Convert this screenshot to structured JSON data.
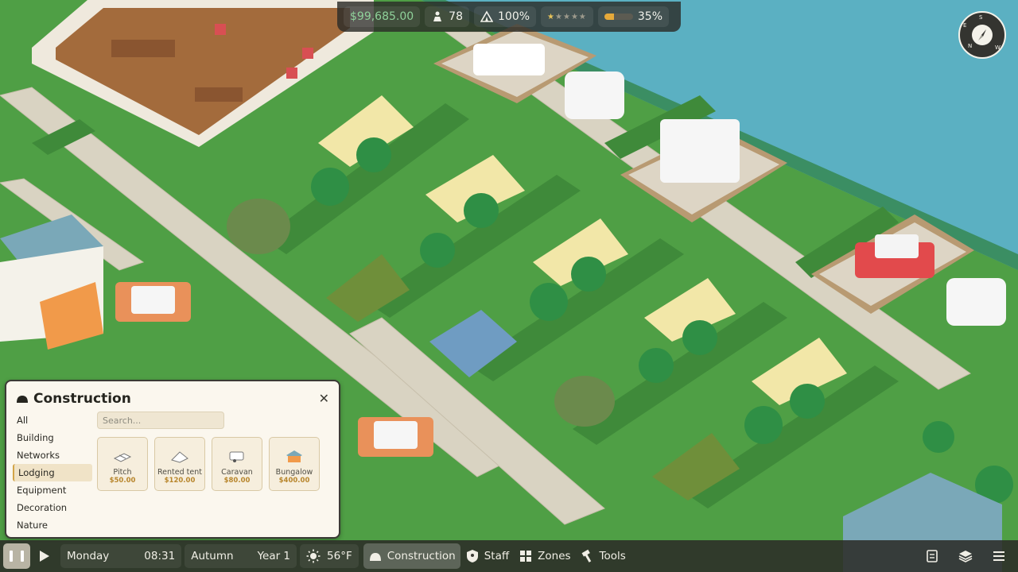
{
  "stats": {
    "money": "$99,685.00",
    "guests": "78",
    "capacity": "100%",
    "rating": 1,
    "rating_max": 5,
    "progress_label": "35%",
    "progress": 0.35
  },
  "compass": {
    "n": "N",
    "e": "E",
    "s": "S",
    "w": "W"
  },
  "construction": {
    "title": "Construction",
    "search_placeholder": "Search...",
    "categories": [
      {
        "label": "All"
      },
      {
        "label": "Building"
      },
      {
        "label": "Networks"
      },
      {
        "label": "Lodging",
        "active": true
      },
      {
        "label": "Equipment"
      },
      {
        "label": "Decoration"
      },
      {
        "label": "Nature"
      }
    ],
    "items": [
      {
        "name": "Pitch",
        "price": "$50.00",
        "icon": "pitch-icon"
      },
      {
        "name": "Rented tent",
        "price": "$120.00",
        "icon": "tent-icon"
      },
      {
        "name": "Caravan",
        "price": "$80.00",
        "icon": "caravan-icon"
      },
      {
        "name": "Bungalow",
        "price": "$400.00",
        "icon": "bungalow-icon"
      }
    ]
  },
  "bottombar": {
    "day": "Monday",
    "time": "08:31",
    "season": "Autumn",
    "year": "Year 1",
    "temperature": "56°F",
    "construction": "Construction",
    "staff": "Staff",
    "zones": "Zones",
    "tools": "Tools"
  },
  "colors": {
    "grass": "#4f9f45",
    "hedge": "#3f8a3a",
    "water": "#5bb0c2",
    "path": "#d9d3c2",
    "panel": "#fbf7ee",
    "accent": "#d2a447"
  }
}
